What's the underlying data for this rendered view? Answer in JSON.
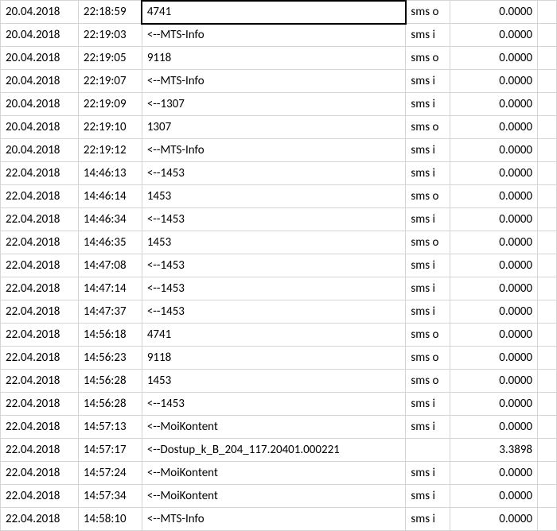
{
  "rows": [
    {
      "date": "20.04.2018",
      "time": "22:18:59",
      "desc": "4741",
      "type": "sms o",
      "val": "0.0000",
      "selected": true
    },
    {
      "date": "20.04.2018",
      "time": "22:19:03",
      "desc": "<--MTS-Info",
      "type": "sms i",
      "val": "0.0000"
    },
    {
      "date": "20.04.2018",
      "time": "22:19:05",
      "desc": "9118",
      "type": "sms o",
      "val": "0.0000"
    },
    {
      "date": "20.04.2018",
      "time": "22:19:07",
      "desc": "<--MTS-Info",
      "type": "sms i",
      "val": "0.0000"
    },
    {
      "date": "20.04.2018",
      "time": "22:19:09",
      "desc": "<--1307",
      "type": "sms i",
      "val": "0.0000"
    },
    {
      "date": "20.04.2018",
      "time": "22:19:10",
      "desc": "1307",
      "type": "sms o",
      "val": "0.0000"
    },
    {
      "date": "20.04.2018",
      "time": "22:19:12",
      "desc": "<--MTS-Info",
      "type": "sms i",
      "val": "0.0000"
    },
    {
      "date": "22.04.2018",
      "time": "14:46:13",
      "desc": "<--1453",
      "type": "sms i",
      "val": "0.0000"
    },
    {
      "date": "22.04.2018",
      "time": "14:46:14",
      "desc": "1453",
      "type": "sms o",
      "val": "0.0000"
    },
    {
      "date": "22.04.2018",
      "time": "14:46:34",
      "desc": "<--1453",
      "type": "sms i",
      "val": "0.0000"
    },
    {
      "date": "22.04.2018",
      "time": "14:46:35",
      "desc": "1453",
      "type": "sms o",
      "val": "0.0000"
    },
    {
      "date": "22.04.2018",
      "time": "14:47:08",
      "desc": "<--1453",
      "type": "sms i",
      "val": "0.0000"
    },
    {
      "date": "22.04.2018",
      "time": "14:47:14",
      "desc": "<--1453",
      "type": "sms i",
      "val": "0.0000"
    },
    {
      "date": "22.04.2018",
      "time": "14:47:37",
      "desc": "<--1453",
      "type": "sms i",
      "val": "0.0000"
    },
    {
      "date": "22.04.2018",
      "time": "14:56:18",
      "desc": "4741",
      "type": "sms o",
      "val": "0.0000"
    },
    {
      "date": "22.04.2018",
      "time": "14:56:23",
      "desc": "9118",
      "type": "sms o",
      "val": "0.0000"
    },
    {
      "date": "22.04.2018",
      "time": "14:56:28",
      "desc": "1453",
      "type": "sms o",
      "val": "0.0000"
    },
    {
      "date": "22.04.2018",
      "time": "14:56:28",
      "desc": "<--1453",
      "type": "sms i",
      "val": "0.0000"
    },
    {
      "date": "22.04.2018",
      "time": "14:57:13",
      "desc": "<--MoiKontent",
      "type": "sms i",
      "val": "0.0000"
    },
    {
      "date": "22.04.2018",
      "time": "14:57:17",
      "desc": "<--Dostup_k_B_204_117.20401.000221",
      "type": "",
      "val": "3.3898"
    },
    {
      "date": "22.04.2018",
      "time": "14:57:24",
      "desc": "<--MoiKontent",
      "type": "sms i",
      "val": "0.0000"
    },
    {
      "date": "22.04.2018",
      "time": "14:57:34",
      "desc": "<--MoiKontent",
      "type": "sms i",
      "val": "0.0000"
    },
    {
      "date": "22.04.2018",
      "time": "14:58:10",
      "desc": "<--MTS-Info",
      "type": "sms i",
      "val": "0.0000"
    }
  ]
}
